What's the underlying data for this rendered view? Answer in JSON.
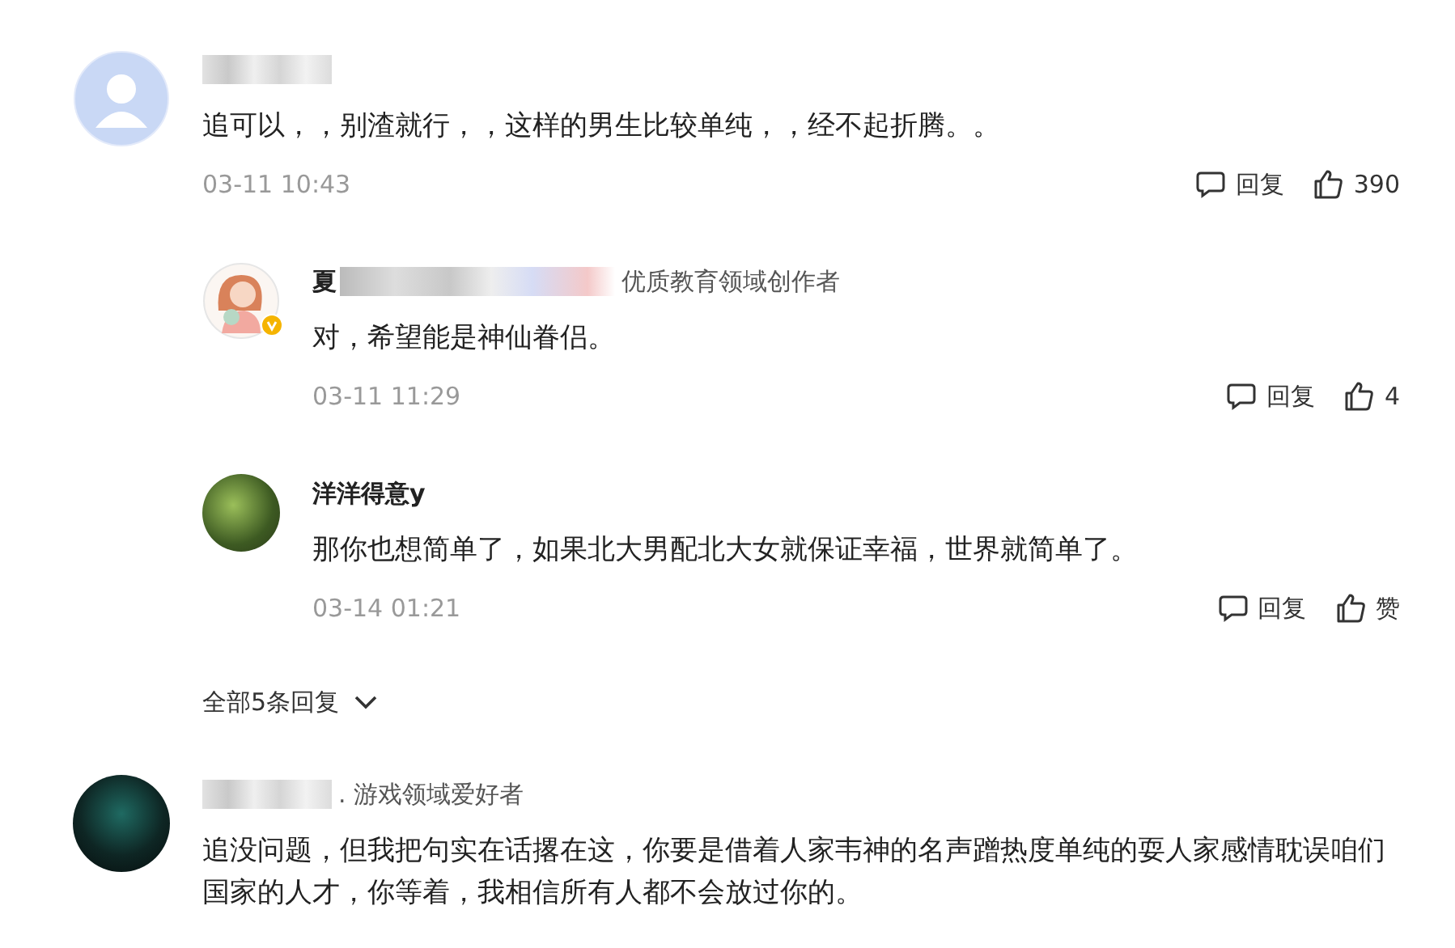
{
  "comments": [
    {
      "avatar": {
        "kind": "default"
      },
      "name_blurred": true,
      "text": "追可以，，别渣就行，，这样的男生比较单纯，，经不起折腾。。",
      "time": "03-11 10:43",
      "reply_label": "回复",
      "like_label": "390",
      "replies": [
        {
          "avatar": {
            "kind": "illustration"
          },
          "verified": true,
          "name": "夏",
          "name_blurred": true,
          "badge": "优质教育领域创作者",
          "text": "对，希望能是神仙眷侣。",
          "time": "03-11 11:29",
          "reply_label": "回复",
          "like_label": "4"
        },
        {
          "avatar": {
            "kind": "photo"
          },
          "verified": false,
          "name": "洋洋得意y",
          "text": "那你也想简单了，如果北大男配北大女就保证幸福，世界就简单了。",
          "time": "03-14 01:21",
          "reply_label": "回复",
          "like_label": "赞"
        }
      ],
      "more_replies": "全部5条回复"
    },
    {
      "avatar": {
        "kind": "dark"
      },
      "name_blurred": true,
      "badge": ". 游戏领域爱好者",
      "text": "追没问题，但我把句实在话撂在这，你要是借着人家韦神的名声蹭热度单纯的耍人家感情耽误咱们国家的人才，你等着，我相信所有人都不会放过你的。"
    }
  ]
}
